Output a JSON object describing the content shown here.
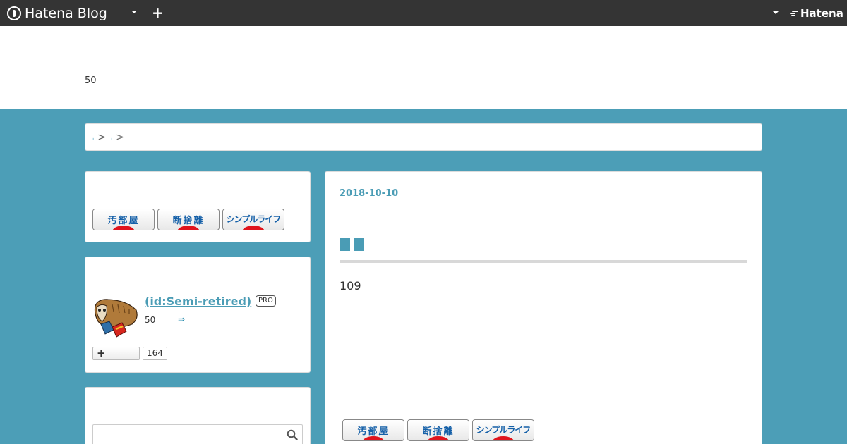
{
  "topbar": {
    "logo_text": "Hatena Blog",
    "hatena_text": "Hatena",
    "icons": [
      "hatena-logo-icon",
      "chevron-down-icon",
      "plus-icon",
      "chevron-down-icon"
    ]
  },
  "header": {
    "description": "50"
  },
  "breadcrumb": {
    "separator": ">"
  },
  "sidebar": {
    "banners": [
      {
        "label": "汚部屋"
      },
      {
        "label": "断捨離"
      },
      {
        "label": "シンプルライフ"
      }
    ],
    "profile": {
      "name": " (id:Semi-retired)",
      "badge": "PRO",
      "count": "50",
      "arrow": "⇒",
      "follow_label": "+",
      "follow_count": "164"
    },
    "search": {
      "placeholder": ""
    }
  },
  "main": {
    "date": "2018-10-10",
    "body": "109",
    "banners": [
      {
        "label": "汚部屋"
      },
      {
        "label": "断捨離"
      },
      {
        "label": "シンプルライフ"
      }
    ]
  },
  "colors": {
    "topbar": "#343434",
    "background": "#4c9eb7",
    "accent": "#4a9cb5",
    "banner_text": "#1560a8",
    "banner_dot": "#e0141c"
  }
}
